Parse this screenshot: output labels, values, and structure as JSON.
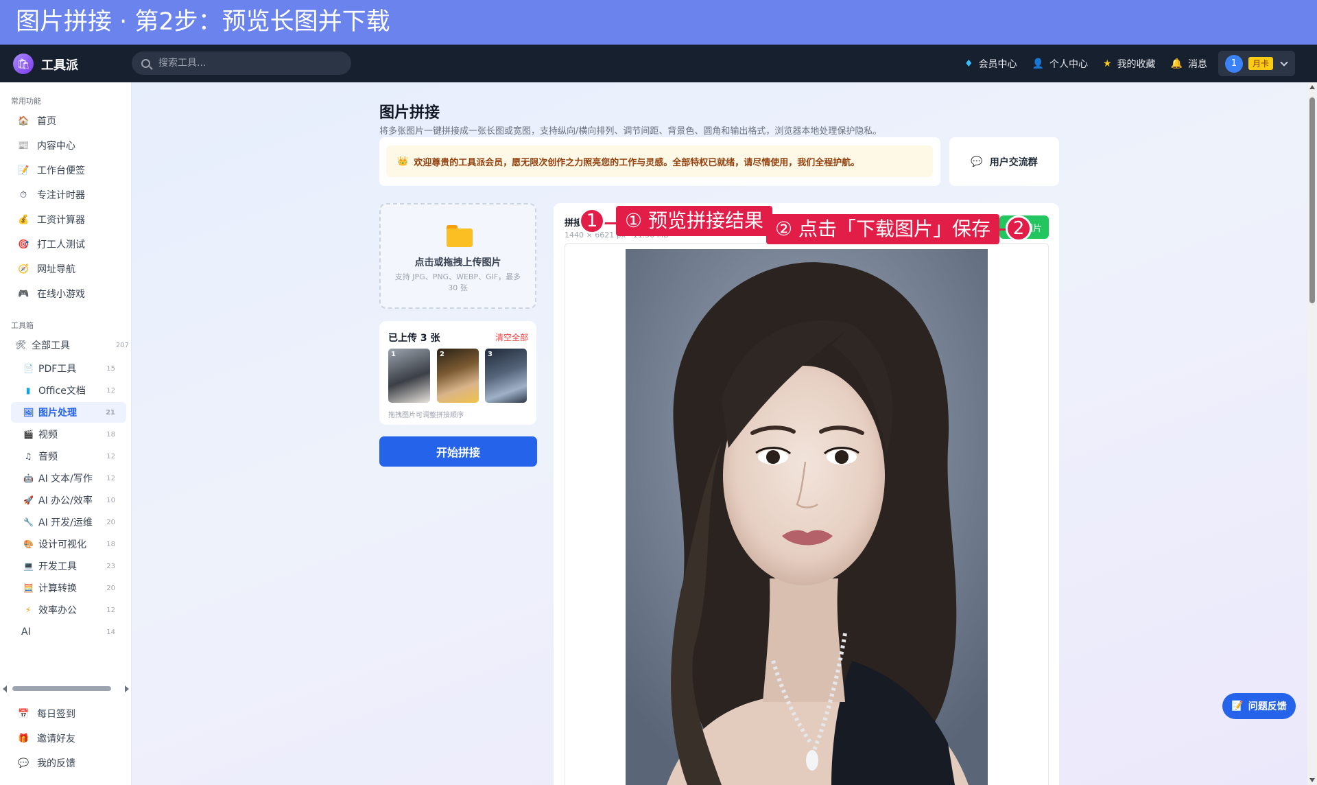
{
  "banner": {
    "title": "图片拼接 · 第2步：预览长图并下载"
  },
  "topbar": {
    "logo_text": "工具派",
    "search_placeholder": "搜索工具...",
    "links": [
      {
        "icon": "diamond-icon",
        "label": "会员中心"
      },
      {
        "icon": "person-icon",
        "label": "个人中心"
      },
      {
        "icon": "star-icon",
        "label": "我的收藏"
      },
      {
        "icon": "bell-icon",
        "label": "消息"
      }
    ],
    "user": {
      "avatar_text": "1",
      "badge": "月卡"
    }
  },
  "sidebar": {
    "common_title": "常用功能",
    "common_items": [
      {
        "icon": "home-icon",
        "label": "首页"
      },
      {
        "icon": "newspaper-icon",
        "label": "内容中心"
      },
      {
        "icon": "notepad-icon",
        "label": "工作台便签"
      },
      {
        "icon": "stopwatch-icon",
        "label": "专注计时器"
      },
      {
        "icon": "money-bag-icon",
        "label": "工资计算器"
      },
      {
        "icon": "target-icon",
        "label": "打工人测试"
      },
      {
        "icon": "compass-icon",
        "label": "网址导航"
      },
      {
        "icon": "gamepad-icon",
        "label": "在线小游戏"
      }
    ],
    "toolbox_title": "工具箱",
    "all_tools": {
      "label": "全部工具",
      "count": "207"
    },
    "tools": [
      {
        "icon": "pdf-icon",
        "label": "PDF工具",
        "count": "15"
      },
      {
        "icon": "office-icon",
        "label": "Office文档",
        "count": "12"
      },
      {
        "icon": "image-icon",
        "label": "图片处理",
        "count": "21",
        "active": true
      },
      {
        "icon": "video-icon",
        "label": "视频",
        "count": "18"
      },
      {
        "icon": "music-icon",
        "label": "音频",
        "count": "12"
      },
      {
        "icon": "ai-writing-icon",
        "label": "AI 文本/写作",
        "count": "12"
      },
      {
        "icon": "ai-office-icon",
        "label": "AI 办公/效率",
        "count": "10"
      },
      {
        "icon": "ai-dev-icon",
        "label": "AI 开发/运维",
        "count": "20"
      },
      {
        "icon": "palette-icon",
        "label": "设计可视化",
        "count": "18"
      },
      {
        "icon": "laptop-icon",
        "label": "开发工具",
        "count": "23"
      },
      {
        "icon": "calculator-icon",
        "label": "计算转换",
        "count": "20"
      },
      {
        "icon": "lightning-icon",
        "label": "效率办公",
        "count": "12"
      },
      {
        "icon": "",
        "label": "AI",
        "count": "14"
      }
    ],
    "bottom_items": [
      {
        "icon": "calendar-icon",
        "label": "每日签到"
      },
      {
        "icon": "gift-icon",
        "label": "邀请好友"
      },
      {
        "icon": "chat-bubble-icon",
        "label": "我的反馈"
      }
    ]
  },
  "main": {
    "title": "图片拼接",
    "description": "将多张图片一键拼接成一张长图或宽图，支持纵向/横向排列、调节间距、背景色、圆角和输出格式，浏览器本地处理保护隐私。",
    "notice": "欢迎尊贵的工具派会员，愿无限次创作之力照亮您的工作与灵感。全部特权已就绪，请尽情使用，我们全程护航。",
    "group_label": "用户交流群",
    "upload": {
      "title": "点击或拖拽上传图片",
      "subtitle": "支持 JPG、PNG、WEBP、GIF，最多 30 张"
    },
    "uploaded": {
      "title": "已上传 3 张",
      "clear": "清空全部",
      "thumbs": [
        "1",
        "2",
        "3"
      ],
      "hint": "拖拽图片可调整拼接顺序"
    },
    "start_button": "开始拼接",
    "preview": {
      "label": "拼接",
      "size": "1440 × 6621 px · 11.56 MB",
      "download_button": "下载图片"
    }
  },
  "annotations": {
    "step1_number": "1",
    "step1_text": "① 预览拼接结果",
    "step2_number": "2",
    "step2_text": "② 点击「下载图片」保存"
  },
  "feedback_button": "问题反馈",
  "colors": {
    "banner": "#6b83ec",
    "topbar": "#17202f",
    "primary": "#2563eb",
    "annotation": "#e11d48",
    "download": "#22c55e"
  }
}
